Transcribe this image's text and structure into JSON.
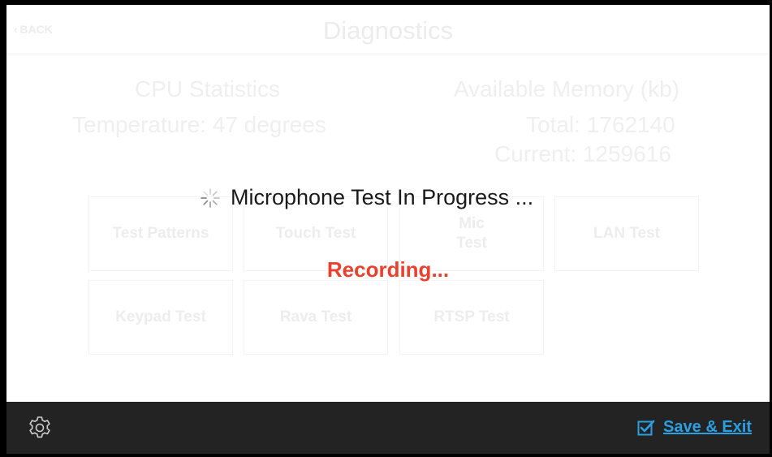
{
  "header": {
    "back_label": "BACK",
    "title": "Diagnostics"
  },
  "stats": {
    "cpu_heading": "CPU Statistics",
    "cpu_temperature": "Temperature: 47 degrees",
    "memory_heading": "Available Memory (kb)",
    "memory_total": "Total: 1762140",
    "memory_current": "Current: 1259616"
  },
  "tests": {
    "test_patterns": "Test Patterns",
    "touch_test": "Touch Test",
    "mic_test_line1": "Mic",
    "mic_test_line2": "Test",
    "lan_test": "LAN Test",
    "keypad_test": "Keypad Test",
    "rava_test": "Rava Test",
    "rtsp_test": "RTSP Test"
  },
  "overlay": {
    "progress_text": "Microphone Test In Progress ...",
    "status_text": "Recording..."
  },
  "footer": {
    "save_exit_label": "Save & Exit",
    "accent_color": "#2a9fe3"
  },
  "icons": {
    "back": "chevron-left-icon",
    "spinner": "spinner-icon",
    "settings": "gear-icon",
    "save": "checkbox-checked-icon"
  }
}
